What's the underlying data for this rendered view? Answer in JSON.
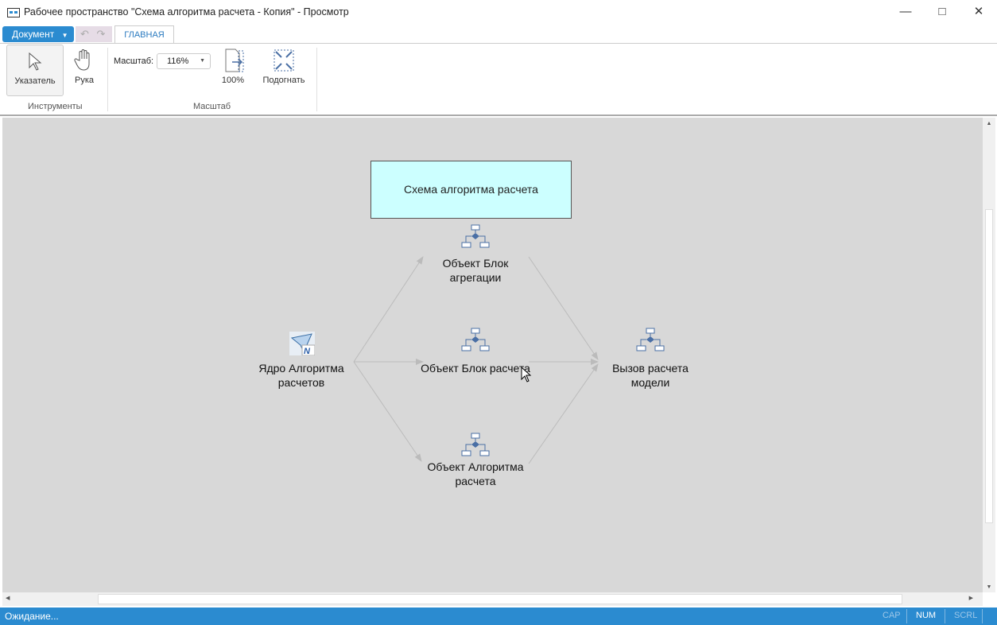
{
  "window": {
    "title": "Рабочее пространство \"Схема алгоритма расчета - Копия\" - Просмотр"
  },
  "menu": {
    "document": "Документ",
    "tab_main": "ГЛАВНАЯ"
  },
  "ribbon": {
    "pointer": "Указатель",
    "hand": "Рука",
    "tools_group": "Инструменты",
    "scale_label": "Масштаб:",
    "scale_value": "116%",
    "zoom100": "100%",
    "fit": "Подогнать",
    "scale_group": "Масштаб"
  },
  "diagram": {
    "title": "Схема алгоритма расчета",
    "title_fill": "#ccffff",
    "nodes": [
      {
        "label": "Ядро Алгоритма расчетов",
        "icon": "calc-core-icon"
      },
      {
        "label": "Объект Блок агрегации",
        "icon": "block-scheme-icon"
      },
      {
        "label": "Объект Блок расчета",
        "icon": "block-scheme-icon"
      },
      {
        "label": "Объект Алгоритма расчета",
        "icon": "block-scheme-icon"
      },
      {
        "label": "Вызов расчета модели",
        "icon": "block-scheme-icon"
      }
    ]
  },
  "status": {
    "text": "Ожидание...",
    "cap": "CAP",
    "num": "NUM",
    "scrl": "SCRL"
  }
}
